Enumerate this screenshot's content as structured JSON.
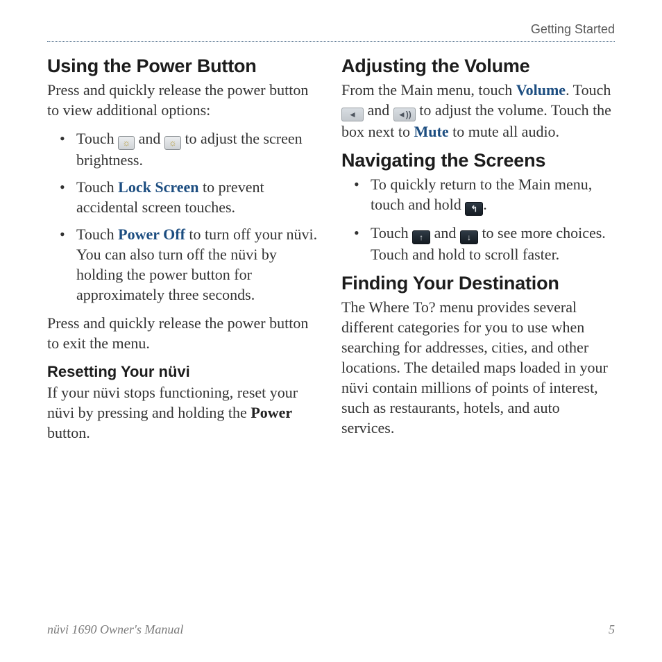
{
  "header": {
    "running_head": "Getting Started"
  },
  "left": {
    "h1": "Using the Power Button",
    "intro": "Press and quickly release the power button to view additional options:",
    "bullets": {
      "b1": {
        "pre": "Touch ",
        "mid": " and ",
        "post": " to adjust the screen brightness."
      },
      "b2": {
        "pre": "Touch ",
        "link": "Lock Screen",
        "post": " to prevent accidental screen touches."
      },
      "b3": {
        "pre": "Touch ",
        "link": "Power Off",
        "post": " to turn off your nüvi. You can also turn off the nüvi by holding the power button for approximately three seconds."
      }
    },
    "outro": "Press and quickly release the power button to exit the menu.",
    "sub_h": "Resetting Your nüvi",
    "sub_p_pre": "If your nüvi stops functioning, reset your nüvi by pressing and holding the ",
    "sub_p_bold": "Power",
    "sub_p_post": " button."
  },
  "right": {
    "vol_h": "Adjusting the Volume",
    "vol_p": {
      "a": "From the Main menu, touch ",
      "volume": "Volume",
      "b": ". Touch ",
      "c": " and ",
      "d": " to adjust the volume. Touch the box next to ",
      "mute": "Mute",
      "e": " to mute all audio."
    },
    "nav_h": "Navigating the Screens",
    "nav_bullets": {
      "n1": {
        "pre": "To quickly return to the Main menu, touch and hold ",
        "post": "."
      },
      "n2": {
        "pre": "Touch ",
        "mid": " and ",
        "post": " to see more choices. Touch and hold to scroll faster."
      }
    },
    "find_h": "Finding Your Destination",
    "find_p": "The Where To? menu provides several different categories for you to use when searching for addresses, cities, and other locations. The detailed maps loaded in your nüvi contain millions of points of interest, such as restaurants, hotels, and auto services."
  },
  "footer": {
    "manual": "nüvi 1690 Owner's Manual",
    "page": "5"
  },
  "icons": {
    "brightness_down": "☼",
    "brightness_up": "☼",
    "speaker_down": "◄",
    "speaker_up": "◄))",
    "back": "↰",
    "up": "↑",
    "down": "↓"
  }
}
